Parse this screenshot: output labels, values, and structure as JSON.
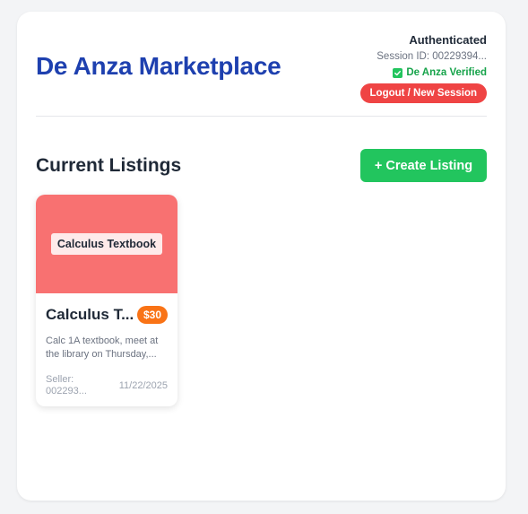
{
  "header": {
    "title": "De Anza Marketplace",
    "auth_status": "Authenticated",
    "session_id": "Session ID: 00229394...",
    "verified_label": "De Anza Verified",
    "logout_label": "Logout / New Session"
  },
  "listings_section": {
    "title": "Current Listings",
    "create_label": "+ Create Listing"
  },
  "listings": [
    {
      "image_label": "Calculus Textbook",
      "title": "Calculus T...",
      "price": "$30",
      "description": "Calc 1A textbook, meet at the library on Thursday,...",
      "seller_label": "Seller:",
      "seller_id": "002293...",
      "date": "11/22/2025",
      "image_color": "#f87171"
    }
  ],
  "colors": {
    "brand": "#1e40af",
    "success": "#22c55e",
    "danger": "#ef4444",
    "price": "#f97316"
  },
  "icons": {
    "verified": "check-icon"
  }
}
